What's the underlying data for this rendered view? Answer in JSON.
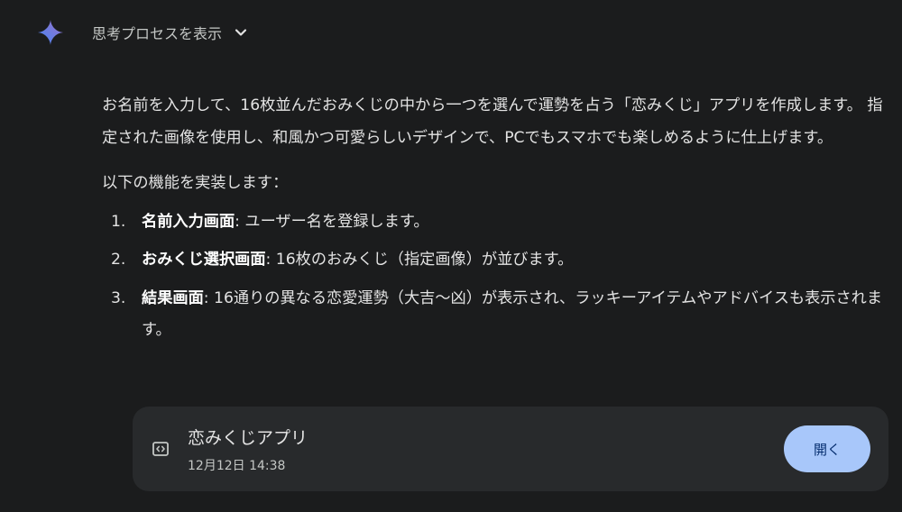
{
  "thought": {
    "label": "思考プロセスを表示",
    "spark_icon": "gemini-spark-icon",
    "toggle_icon": "chevron-down-icon"
  },
  "response": {
    "intro": "お名前を入力して、16枚並んだおみくじの中から一つを選んで運勢を占う「恋みくじ」アプリを作成します。 指定された画像を使用し、和風かつ可愛らしいデザインで、PCでもスマホでも楽しめるように仕上げます。",
    "features_heading": "以下の機能を実装します：",
    "features": [
      {
        "number": "1.",
        "title": "名前入力画面",
        "text": ": ユーザー名を登録します。"
      },
      {
        "number": "2.",
        "title": "おみくじ選択画面",
        "text": ": 16枚のおみくじ（指定画像）が並びます。"
      },
      {
        "number": "3.",
        "title": "結果画面",
        "text": ": 16通りの異なる恋愛運勢（大吉〜凶）が表示され、ラッキーアイテムやアドバイスも表示されます。"
      }
    ]
  },
  "artifact_card": {
    "icon": "code-icon",
    "title": "恋みくじアプリ",
    "timestamp": "12月12日 14:38",
    "open_label": "開く"
  },
  "colors": {
    "background": "#1b1c1d",
    "card_background": "#282a2c",
    "text": "#e3e3e3",
    "secondary_text": "#c4c7c5",
    "button_background": "#a8c7fa",
    "button_text": "#062e6f",
    "spark_gradient": [
      "#4285f4",
      "#9b72cb"
    ]
  }
}
